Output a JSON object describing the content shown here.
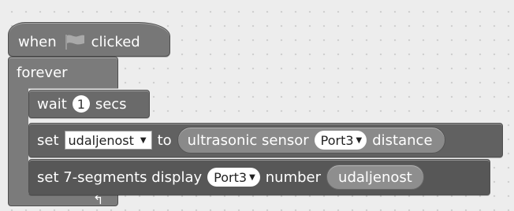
{
  "script": {
    "hat": {
      "when_label": "when",
      "flag_icon": "green-flag-icon",
      "clicked_label": "clicked"
    },
    "forever": {
      "label": "forever",
      "loop_icon": "loop-arrow-icon",
      "loop_glyph": "↰"
    },
    "wait": {
      "label": "wait",
      "value": "1",
      "unit_label": "secs"
    },
    "set_variable": {
      "set_label": "set",
      "variable": "udaljenost",
      "to_label": "to",
      "reporter": {
        "prefix": "ultrasonic sensor",
        "port": "Port3",
        "suffix": "distance"
      }
    },
    "set_display": {
      "label": "set 7-segments display",
      "port": "Port3",
      "number_label": "number",
      "value_reporter": "udaljenost"
    }
  },
  "colors": {
    "block": "#6f6f6f",
    "slot": "#ffffff",
    "background": "#ededed"
  }
}
